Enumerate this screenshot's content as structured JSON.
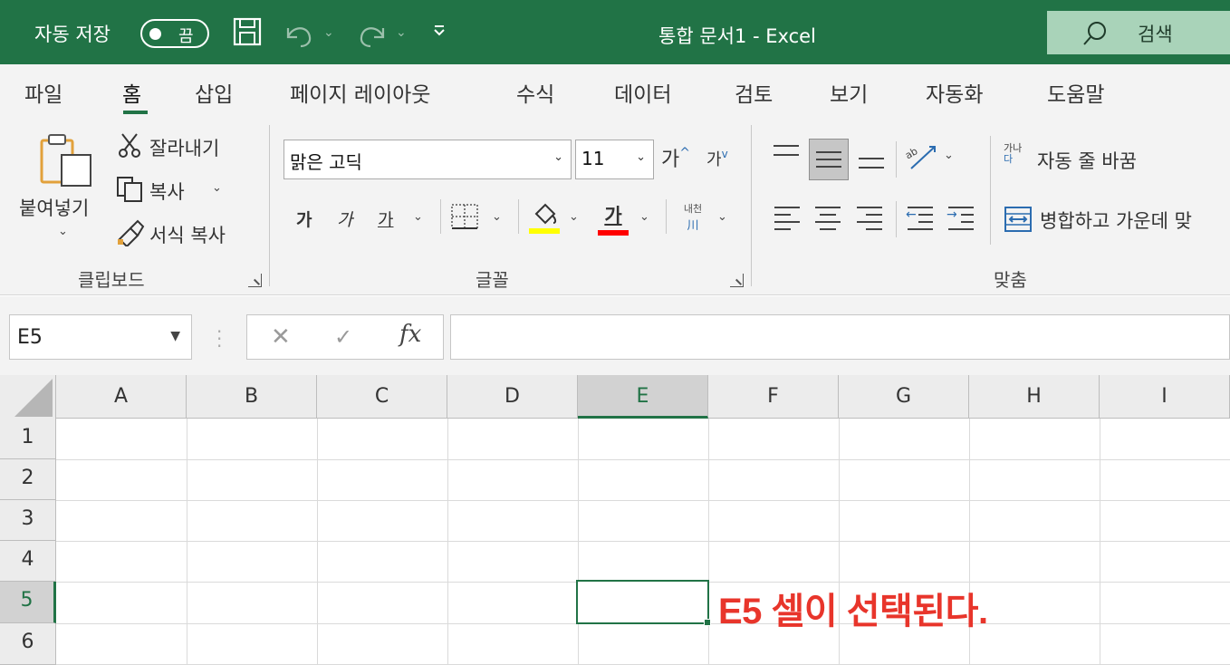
{
  "titlebar": {
    "autosave_label": "자동 저장",
    "autosave_toggle": "끔",
    "document_title": "통합 문서1  -  Excel",
    "search_label": "검색"
  },
  "tabs": [
    "파일",
    "홈",
    "삽입",
    "페이지 레이아웃",
    "수식",
    "데이터",
    "검토",
    "보기",
    "자동화",
    "도움말"
  ],
  "active_tab": "홈",
  "clipboard": {
    "paste": "붙여넣기",
    "cut": "잘라내기",
    "copy": "복사",
    "format_painter": "서식 복사",
    "group_label": "클립보드"
  },
  "font": {
    "font_name": "맑은 고딕",
    "font_size": "11",
    "grow": "가",
    "shrink": "가",
    "bold": "가",
    "italic": "가",
    "underline": "가",
    "font_color_glyph": "가",
    "phonetic_top": "내천",
    "phonetic_bottom": "川",
    "group_label": "글꼴"
  },
  "alignment": {
    "orientation_glyph": "ab",
    "wrap_text": "자동 줄 바꿈",
    "merge_center": "병합하고 가운데 맞",
    "wrap_icon_top": "가나",
    "wrap_icon_bottom": "다",
    "group_label": "맞춤"
  },
  "colors": {
    "accent": "#217346",
    "fill_yellow": "#ffff00",
    "font_red": "#ff0000",
    "annotation_red": "#e8352b"
  },
  "formula_bar": {
    "name_box": "E5",
    "fx": "fx",
    "formula": ""
  },
  "sheet": {
    "columns": [
      "A",
      "B",
      "C",
      "D",
      "E",
      "F",
      "G",
      "H",
      "I"
    ],
    "rows": [
      "1",
      "2",
      "3",
      "4",
      "5",
      "6"
    ],
    "selected_cell": "E5"
  },
  "annotation": "E5 셀이 선택된다."
}
